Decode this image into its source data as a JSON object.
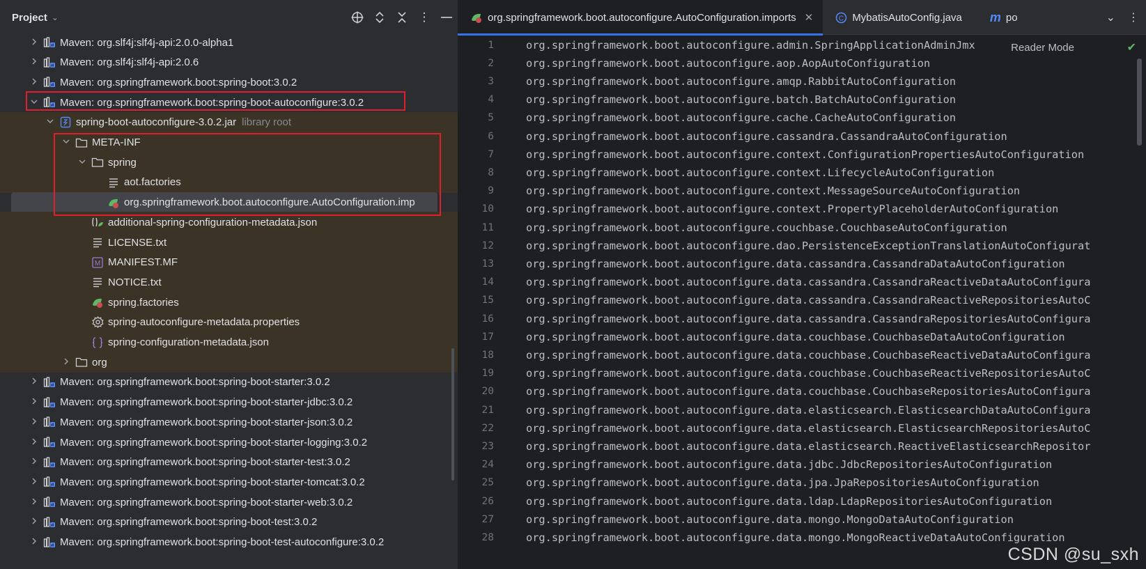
{
  "project_panel": {
    "title": "Project",
    "header_icons": [
      "locate-icon",
      "expand-all-icon",
      "collapse-all-icon",
      "more-vertical-icon",
      "minimize-icon"
    ]
  },
  "tree": [
    {
      "label": "Maven: org.slf4j:slf4j-api:2.0.0-alpha1",
      "indent": 0,
      "arrow": "collapsed",
      "icon": "library-icon"
    },
    {
      "label": "Maven: org.slf4j:slf4j-api:2.0.6",
      "indent": 0,
      "arrow": "collapsed",
      "icon": "library-icon"
    },
    {
      "label": "Maven: org.springframework.boot:spring-boot:3.0.2",
      "indent": 0,
      "arrow": "collapsed",
      "icon": "library-icon"
    },
    {
      "label": "Maven: org.springframework.boot:spring-boot-autoconfigure:3.0.2",
      "indent": 0,
      "arrow": "expanded",
      "icon": "library-icon"
    },
    {
      "label": "spring-boot-autoconfigure-3.0.2.jar",
      "hint": "library root",
      "indent": 1,
      "arrow": "expanded",
      "icon": "jar-icon"
    },
    {
      "label": "META-INF",
      "indent": 2,
      "arrow": "expanded",
      "icon": "folder-icon"
    },
    {
      "label": "spring",
      "indent": 3,
      "arrow": "expanded",
      "icon": "folder-icon"
    },
    {
      "label": "aot.factories",
      "indent": 4,
      "arrow": "none",
      "icon": "text-file-icon"
    },
    {
      "label": "org.springframework.boot.autoconfigure.AutoConfiguration.imp",
      "indent": 4,
      "arrow": "none",
      "icon": "spring-file-icon",
      "selected": true
    },
    {
      "label": "additional-spring-configuration-metadata.json",
      "indent": 3,
      "arrow": "none",
      "icon": "spring-json-icon"
    },
    {
      "label": "LICENSE.txt",
      "indent": 3,
      "arrow": "none",
      "icon": "text-file-icon"
    },
    {
      "label": "MANIFEST.MF",
      "indent": 3,
      "arrow": "none",
      "icon": "manifest-icon"
    },
    {
      "label": "NOTICE.txt",
      "indent": 3,
      "arrow": "none",
      "icon": "text-file-icon"
    },
    {
      "label": "spring.factories",
      "indent": 3,
      "arrow": "none",
      "icon": "spring-file-icon"
    },
    {
      "label": "spring-autoconfigure-metadata.properties",
      "indent": 3,
      "arrow": "none",
      "icon": "gear-icon"
    },
    {
      "label": "spring-configuration-metadata.json",
      "indent": 3,
      "arrow": "none",
      "icon": "json-icon"
    },
    {
      "label": "org",
      "indent": 2,
      "arrow": "collapsed",
      "icon": "folder-icon"
    },
    {
      "label": "Maven: org.springframework.boot:spring-boot-starter:3.0.2",
      "indent": 0,
      "arrow": "collapsed",
      "icon": "library-icon"
    },
    {
      "label": "Maven: org.springframework.boot:spring-boot-starter-jdbc:3.0.2",
      "indent": 0,
      "arrow": "collapsed",
      "icon": "library-icon"
    },
    {
      "label": "Maven: org.springframework.boot:spring-boot-starter-json:3.0.2",
      "indent": 0,
      "arrow": "collapsed",
      "icon": "library-icon"
    },
    {
      "label": "Maven: org.springframework.boot:spring-boot-starter-logging:3.0.2",
      "indent": 0,
      "arrow": "collapsed",
      "icon": "library-icon"
    },
    {
      "label": "Maven: org.springframework.boot:spring-boot-starter-test:3.0.2",
      "indent": 0,
      "arrow": "collapsed",
      "icon": "library-icon"
    },
    {
      "label": "Maven: org.springframework.boot:spring-boot-starter-tomcat:3.0.2",
      "indent": 0,
      "arrow": "collapsed",
      "icon": "library-icon"
    },
    {
      "label": "Maven: org.springframework.boot:spring-boot-starter-web:3.0.2",
      "indent": 0,
      "arrow": "collapsed",
      "icon": "library-icon"
    },
    {
      "label": "Maven: org.springframework.boot:spring-boot-test:3.0.2",
      "indent": 0,
      "arrow": "collapsed",
      "icon": "library-icon"
    },
    {
      "label": "Maven: org.springframework.boot:spring-boot-test-autoconfigure:3.0.2",
      "indent": 0,
      "arrow": "collapsed",
      "icon": "library-icon"
    }
  ],
  "tabs": [
    {
      "label": "org.springframework.boot.autoconfigure.AutoConfiguration.imports",
      "icon": "spring-file-icon",
      "active": true,
      "closable": true
    },
    {
      "label": "MybatisAutoConfig.java",
      "icon": "class-icon",
      "active": false,
      "closable": false
    },
    {
      "label": "po",
      "icon": "mybatis-icon",
      "active": false,
      "closable": false
    }
  ],
  "editor": {
    "reader_mode": "Reader Mode",
    "lines": [
      "org.springframework.boot.autoconfigure.admin.SpringApplicationAdminJmx",
      "org.springframework.boot.autoconfigure.aop.AopAutoConfiguration",
      "org.springframework.boot.autoconfigure.amqp.RabbitAutoConfiguration",
      "org.springframework.boot.autoconfigure.batch.BatchAutoConfiguration",
      "org.springframework.boot.autoconfigure.cache.CacheAutoConfiguration",
      "org.springframework.boot.autoconfigure.cassandra.CassandraAutoConfiguration",
      "org.springframework.boot.autoconfigure.context.ConfigurationPropertiesAutoConfiguration",
      "org.springframework.boot.autoconfigure.context.LifecycleAutoConfiguration",
      "org.springframework.boot.autoconfigure.context.MessageSourceAutoConfiguration",
      "org.springframework.boot.autoconfigure.context.PropertyPlaceholderAutoConfiguration",
      "org.springframework.boot.autoconfigure.couchbase.CouchbaseAutoConfiguration",
      "org.springframework.boot.autoconfigure.dao.PersistenceExceptionTranslationAutoConfigurat",
      "org.springframework.boot.autoconfigure.data.cassandra.CassandraDataAutoConfiguration",
      "org.springframework.boot.autoconfigure.data.cassandra.CassandraReactiveDataAutoConfigura",
      "org.springframework.boot.autoconfigure.data.cassandra.CassandraReactiveRepositoriesAutoC",
      "org.springframework.boot.autoconfigure.data.cassandra.CassandraRepositoriesAutoConfigura",
      "org.springframework.boot.autoconfigure.data.couchbase.CouchbaseDataAutoConfiguration",
      "org.springframework.boot.autoconfigure.data.couchbase.CouchbaseReactiveDataAutoConfigura",
      "org.springframework.boot.autoconfigure.data.couchbase.CouchbaseReactiveRepositoriesAutoC",
      "org.springframework.boot.autoconfigure.data.couchbase.CouchbaseRepositoriesAutoConfigura",
      "org.springframework.boot.autoconfigure.data.elasticsearch.ElasticsearchDataAutoConfigura",
      "org.springframework.boot.autoconfigure.data.elasticsearch.ElasticsearchRepositoriesAutoC",
      "org.springframework.boot.autoconfigure.data.elasticsearch.ReactiveElasticsearchRepositor",
      "org.springframework.boot.autoconfigure.data.jdbc.JdbcRepositoriesAutoConfiguration",
      "org.springframework.boot.autoconfigure.data.jpa.JpaRepositoriesAutoConfiguration",
      "org.springframework.boot.autoconfigure.data.ldap.LdapRepositoriesAutoConfiguration",
      "org.springframework.boot.autoconfigure.data.mongo.MongoDataAutoConfiguration",
      "org.springframework.boot.autoconfigure.data.mongo.MongoReactiveDataAutoConfiguration"
    ]
  },
  "watermark": "CSDN @su_sxh",
  "colors": {
    "panel_bg": "#2b2d30",
    "editor_bg": "#1e1f22",
    "highlight_bg": "#3b3326",
    "selected_bg": "#43454a",
    "annotation_red": "#e01f2e",
    "accent_blue": "#3574f0",
    "spring_green": "#5fb865"
  }
}
